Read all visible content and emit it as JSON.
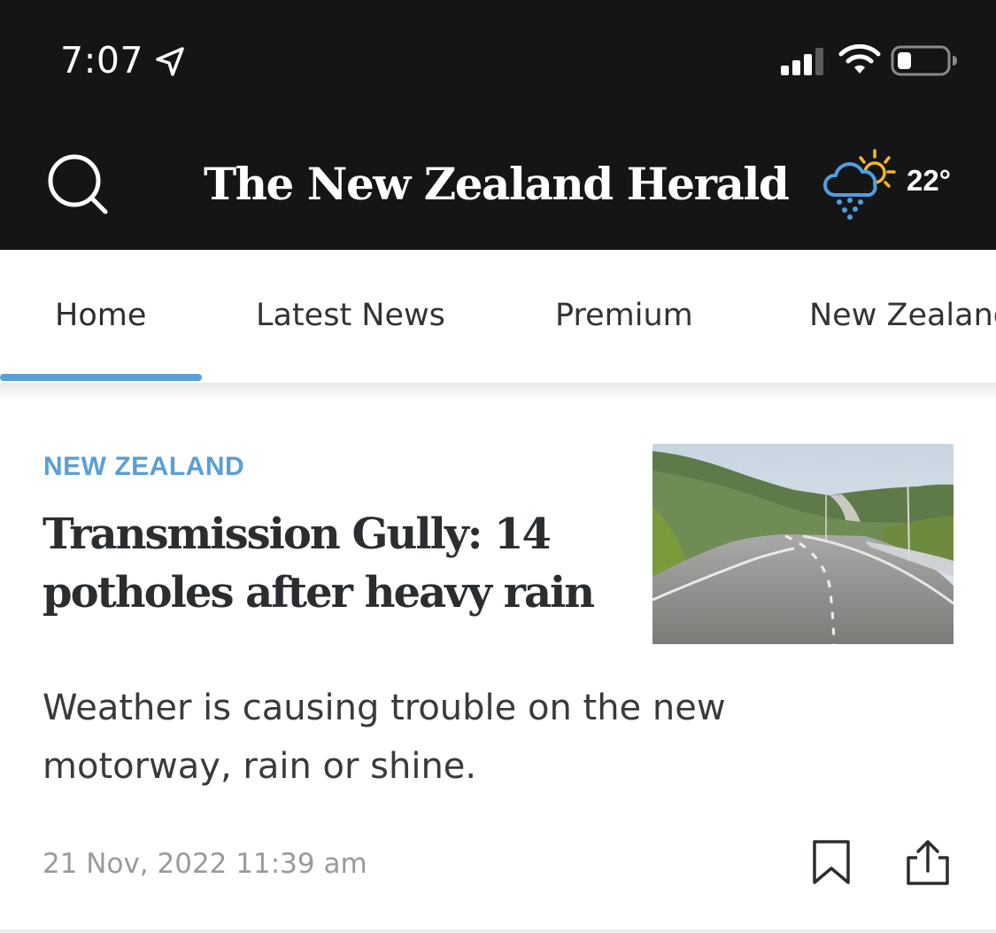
{
  "status_bar": {
    "time": "7:07",
    "location_icon": "location-arrow-icon",
    "signal_icon": "cellular-signal-icon",
    "wifi_icon": "wifi-icon",
    "battery_icon": "battery-icon",
    "battery_level": 0.25
  },
  "header": {
    "search_icon": "search-icon",
    "masthead": "The New Zealand Herald",
    "weather_icon": "rain-sun-weather-icon",
    "temperature": "22°",
    "background_color": "#151515"
  },
  "tabs": {
    "items": [
      {
        "label": "Home",
        "selected": true
      },
      {
        "label": "Latest News",
        "selected": false
      },
      {
        "label": "Premium",
        "selected": false
      },
      {
        "label": "New Zealand",
        "selected": false
      }
    ],
    "accent_color": "#5a9fd6"
  },
  "article": {
    "category": "NEW ZEALAND",
    "headline": "Transmission Gully: 14 potholes after heavy rain",
    "summary": "Weather is causing trouble on the new motorway, rain or shine.",
    "timestamp": "21 Nov, 2022 11:39 am",
    "image": "motorway-road-photo",
    "bookmark_icon": "bookmark-icon",
    "share_icon": "share-icon"
  }
}
